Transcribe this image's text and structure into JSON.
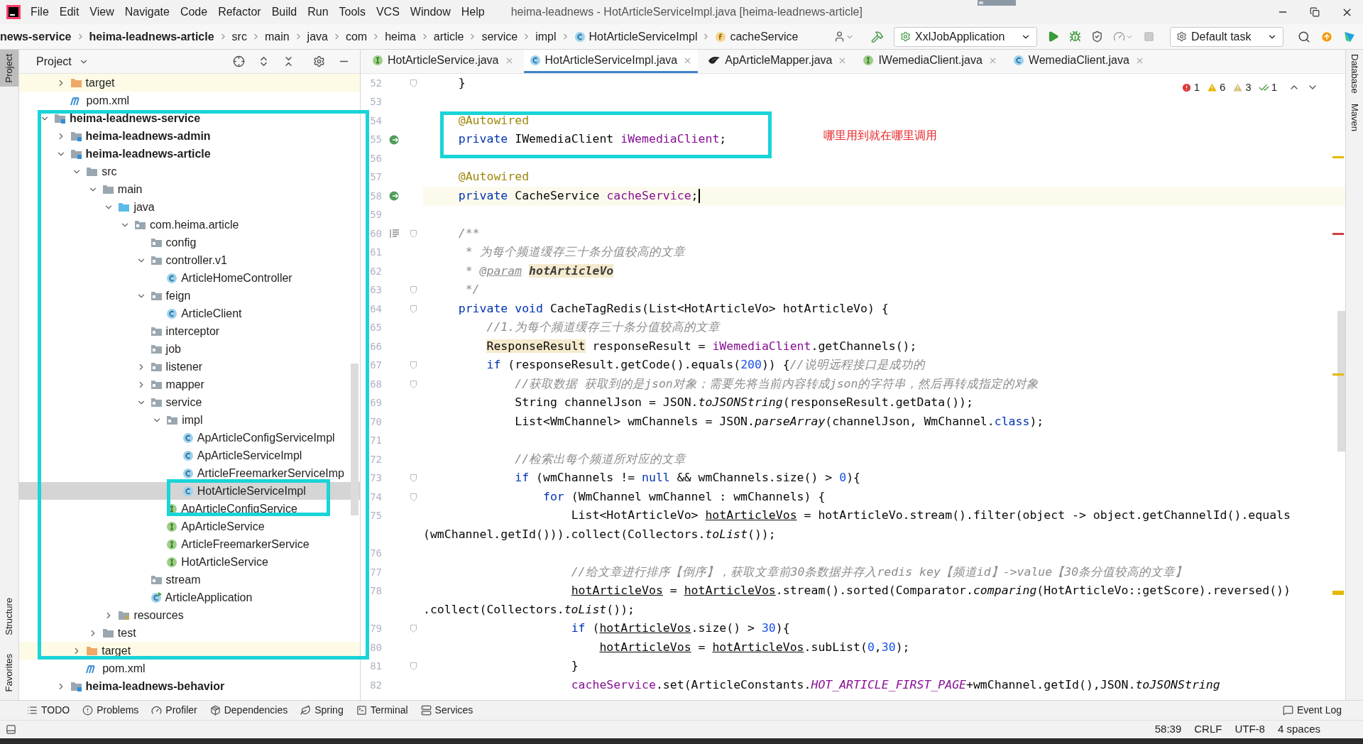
{
  "window": {
    "title": "heima-leadnews - HotArticleServiceImpl.java [heima-leadnews-article]"
  },
  "menu": [
    "File",
    "Edit",
    "View",
    "Navigate",
    "Code",
    "Refactor",
    "Build",
    "Run",
    "Tools",
    "VCS",
    "Window",
    "Help"
  ],
  "breadcrumbs": [
    {
      "label": "news-service",
      "kind": "module"
    },
    {
      "label": "heima-leadnews-article",
      "kind": "module"
    },
    {
      "label": "src",
      "kind": "folder"
    },
    {
      "label": "main",
      "kind": "folder"
    },
    {
      "label": "java",
      "kind": "folder"
    },
    {
      "label": "com",
      "kind": "folder"
    },
    {
      "label": "heima",
      "kind": "folder"
    },
    {
      "label": "article",
      "kind": "folder"
    },
    {
      "label": "service",
      "kind": "folder"
    },
    {
      "label": "impl",
      "kind": "folder"
    },
    {
      "label": "HotArticleServiceImpl",
      "kind": "class"
    },
    {
      "label": "cacheService",
      "kind": "field"
    }
  ],
  "toolbar": {
    "run_config": "XxlJobApplication",
    "task": "Default task"
  },
  "left_stripe": [
    {
      "label": "Project",
      "selected": true
    },
    {
      "label": "Structure",
      "selected": false
    },
    {
      "label": "Favorites",
      "selected": false
    }
  ],
  "project_panel": {
    "title": "Project",
    "orphan_items": [
      {
        "label": "target",
        "kind": "excluded",
        "expanded": false,
        "selected": false
      },
      {
        "label": "pom.xml",
        "kind": "maven",
        "selected": false
      }
    ],
    "items": [
      {
        "label": "heima-leadnews-service",
        "kind": "module",
        "expanded": true,
        "selected": false,
        "children": [
          {
            "label": "heima-leadnews-admin",
            "kind": "module",
            "expanded": false,
            "selected": false
          },
          {
            "label": "heima-leadnews-article",
            "kind": "module",
            "expanded": true,
            "selected": false,
            "children": [
              {
                "label": "src",
                "kind": "folder",
                "expanded": true,
                "selected": false,
                "children": [
                  {
                    "label": "main",
                    "kind": "folder",
                    "expanded": true,
                    "selected": false,
                    "children": [
                      {
                        "label": "java",
                        "kind": "source-root",
                        "expanded": true,
                        "selected": false,
                        "children": [
                          {
                            "label": "com.heima.article",
                            "kind": "package",
                            "expanded": true,
                            "selected": false,
                            "children": [
                              {
                                "label": "config",
                                "kind": "package",
                                "selected": false
                              },
                              {
                                "label": "controller.v1",
                                "kind": "package",
                                "expanded": true,
                                "selected": false,
                                "children": [
                                  {
                                    "label": "ArticleHomeController",
                                    "kind": "class",
                                    "selected": false
                                  }
                                ]
                              },
                              {
                                "label": "feign",
                                "kind": "package",
                                "expanded": true,
                                "selected": false,
                                "children": [
                                  {
                                    "label": "ArticleClient",
                                    "kind": "class",
                                    "selected": false
                                  }
                                ]
                              },
                              {
                                "label": "interceptor",
                                "kind": "package",
                                "selected": false
                              },
                              {
                                "label": "job",
                                "kind": "package",
                                "selected": false
                              },
                              {
                                "label": "listener",
                                "kind": "package",
                                "expanded": false,
                                "selected": false
                              },
                              {
                                "label": "mapper",
                                "kind": "package",
                                "expanded": false,
                                "selected": false
                              },
                              {
                                "label": "service",
                                "kind": "package",
                                "expanded": true,
                                "selected": false,
                                "children": [
                                  {
                                    "label": "impl",
                                    "kind": "package",
                                    "expanded": true,
                                    "selected": false,
                                    "children": [
                                      {
                                        "label": "ApArticleConfigServiceImpl",
                                        "kind": "class",
                                        "selected": false
                                      },
                                      {
                                        "label": "ApArticleServiceImpl",
                                        "kind": "class",
                                        "selected": false
                                      },
                                      {
                                        "label": "ArticleFreemarkerServiceImp",
                                        "kind": "class",
                                        "selected": false
                                      },
                                      {
                                        "label": "HotArticleServiceImpl",
                                        "kind": "class",
                                        "selected": true
                                      }
                                    ]
                                  },
                                  {
                                    "label": "ApArticleConfigService",
                                    "kind": "interface",
                                    "selected": false
                                  },
                                  {
                                    "label": "ApArticleService",
                                    "kind": "interface",
                                    "selected": false
                                  },
                                  {
                                    "label": "ArticleFreemarkerService",
                                    "kind": "interface",
                                    "selected": false
                                  },
                                  {
                                    "label": "HotArticleService",
                                    "kind": "interface",
                                    "selected": false
                                  }
                                ]
                              },
                              {
                                "label": "stream",
                                "kind": "package",
                                "selected": false
                              },
                              {
                                "label": "ArticleApplication",
                                "kind": "app",
                                "selected": false
                              }
                            ]
                          }
                        ]
                      },
                      {
                        "label": "resources",
                        "kind": "resources",
                        "expanded": false,
                        "selected": false
                      }
                    ]
                  },
                  {
                    "label": "test",
                    "kind": "folder",
                    "expanded": false,
                    "selected": false
                  }
                ]
              },
              {
                "label": "target",
                "kind": "excluded",
                "expanded": false,
                "selected": false
              },
              {
                "label": "pom.xml",
                "kind": "maven",
                "selected": false
              }
            ]
          },
          {
            "label": "heima-leadnews-behavior",
            "kind": "module",
            "expanded": false,
            "selected": false
          }
        ]
      }
    ]
  },
  "tabs": [
    {
      "label": "HotArticleService.java",
      "kind": "interface",
      "selected": false
    },
    {
      "label": "HotArticleServiceImpl.java",
      "kind": "class",
      "selected": true
    },
    {
      "label": "ApArticleMapper.java",
      "kind": "mapper",
      "selected": false
    },
    {
      "label": "IWemediaClient.java",
      "kind": "interface",
      "selected": false
    },
    {
      "label": "WemediaClient.java",
      "kind": "class",
      "selected": false
    }
  ],
  "editor": {
    "inspections": [
      {
        "kind": "error",
        "count": "1"
      },
      {
        "kind": "warning",
        "count": "6"
      },
      {
        "kind": "weak-warning",
        "count": "3"
      },
      {
        "kind": "typo",
        "count": "1"
      }
    ],
    "note": "哪里用到就在哪里调用",
    "lines": [
      {
        "number": "52",
        "fold": true,
        "tokens": [
          {
            "text": "    }",
            "kind": "plain"
          }
        ]
      },
      {
        "number": "53",
        "fold": false
      },
      {
        "number": "54",
        "fold": false,
        "tokens": [
          {
            "text": "    @Autowired",
            "kind": "annotation"
          }
        ]
      },
      {
        "number": "55",
        "fold": false,
        "gutter": {
          "kind": "bean"
        },
        "tokens": [
          {
            "text": "    private",
            "kind": "keyword"
          },
          {
            "text": " IWemediaClient ",
            "kind": "plain"
          },
          {
            "text": "iWemediaClient",
            "kind": "field"
          },
          {
            "text": ";",
            "kind": "plain"
          }
        ]
      },
      {
        "number": "56",
        "fold": false
      },
      {
        "number": "57",
        "fold": false,
        "tokens": [
          {
            "text": "    @Autowired",
            "kind": "annotation"
          }
        ]
      },
      {
        "number": "58",
        "fold": false,
        "current": true,
        "gutter": {
          "kind": "bean"
        },
        "tokens": [
          {
            "text": "    private",
            "kind": "keyword"
          },
          {
            "text": " CacheService ",
            "kind": "plain"
          },
          {
            "text": "cacheService",
            "kind": "field"
          },
          {
            "text": ";",
            "kind": "plain"
          }
        ]
      },
      {
        "number": "59",
        "fold": false
      },
      {
        "number": "60",
        "fold": true,
        "gutter": {
          "kind": "doc"
        },
        "tokens": [
          {
            "text": "    /**",
            "kind": "comment"
          }
        ]
      },
      {
        "number": "61",
        "fold": false,
        "tokens": [
          {
            "text": "     * 为每个频道缓存三十条分值较高的文章",
            "kind": "comment"
          }
        ]
      },
      {
        "number": "62",
        "fold": false,
        "tokens": [
          {
            "text": "     *",
            "kind": "comment"
          },
          {
            "text": " @param",
            "kind": "doc-tag"
          },
          {
            "text": " hotArticleVo",
            "kind": "doc-param"
          }
        ]
      },
      {
        "number": "63",
        "fold": true,
        "tokens": [
          {
            "text": "     */",
            "kind": "comment"
          }
        ]
      },
      {
        "number": "64",
        "fold": true,
        "tokens": [
          {
            "text": "    private void",
            "kind": "keyword"
          },
          {
            "text": " CacheTagRedis(List<HotArticleVo> hotArticleVo) {",
            "kind": "plain"
          }
        ]
      },
      {
        "number": "65",
        "fold": false,
        "tokens": [
          {
            "text": "        //1.为每个频道缓存三十条分值较高的文章",
            "kind": "comment"
          }
        ]
      },
      {
        "number": "66",
        "fold": false,
        "tokens": [
          {
            "text": "        ResponseResult",
            "kind": "marked"
          },
          {
            "text": " responseResult = ",
            "kind": "plain"
          },
          {
            "text": "iWemediaClient",
            "kind": "field"
          },
          {
            "text": ".getChannels();",
            "kind": "plain"
          }
        ]
      },
      {
        "number": "67",
        "fold": true,
        "tokens": [
          {
            "text": "        if",
            "kind": "keyword"
          },
          {
            "text": " (responseResult.getCode().equals(",
            "kind": "plain"
          },
          {
            "text": "200",
            "kind": "number"
          },
          {
            "text": ")) {",
            "kind": "plain"
          },
          {
            "text": "//说明远程接口是成功的",
            "kind": "comment"
          }
        ]
      },
      {
        "number": "68",
        "fold": true,
        "tokens": [
          {
            "text": "            //获取数据 获取到的是json对象；需要先将当前内容转成json的字符串，然后再转成指定的对象",
            "kind": "comment"
          }
        ]
      },
      {
        "number": "69",
        "fold": false,
        "tokens": [
          {
            "text": "            String channelJson = JSON.",
            "kind": "plain"
          },
          {
            "text": "toJSONString",
            "kind": "static-call"
          },
          {
            "text": "(responseResult.getData());",
            "kind": "plain"
          }
        ]
      },
      {
        "number": "70",
        "fold": false,
        "tokens": [
          {
            "text": "            List<WmChannel> wmChannels = JSON.",
            "kind": "plain"
          },
          {
            "text": "parseArray",
            "kind": "static-call"
          },
          {
            "text": "(channelJson, WmChannel.",
            "kind": "plain"
          },
          {
            "text": "class",
            "kind": "keyword"
          },
          {
            "text": ");",
            "kind": "plain"
          }
        ]
      },
      {
        "number": "71",
        "fold": false
      },
      {
        "number": "72",
        "fold": false,
        "tokens": [
          {
            "text": "            //检索出每个频道所对应的文章",
            "kind": "comment"
          }
        ]
      },
      {
        "number": "73",
        "fold": true,
        "tokens": [
          {
            "text": "            if",
            "kind": "keyword"
          },
          {
            "text": " (wmChannels != ",
            "kind": "plain"
          },
          {
            "text": "null",
            "kind": "keyword"
          },
          {
            "text": " && wmChannels.size() > ",
            "kind": "plain"
          },
          {
            "text": "0",
            "kind": "number"
          },
          {
            "text": "){",
            "kind": "plain"
          }
        ]
      },
      {
        "number": "74",
        "fold": true,
        "tokens": [
          {
            "text": "                for",
            "kind": "keyword"
          },
          {
            "text": " (WmChannel wmChannel : wmChannels) {",
            "kind": "plain"
          }
        ]
      },
      {
        "number": "75",
        "fold": false,
        "tokens": [
          {
            "text": "                    List<HotArticleVo> ",
            "kind": "plain"
          },
          {
            "text": "hotArticleVos",
            "kind": "reassigned"
          },
          {
            "text": " = hotArticleVo.stream().filter(object -> object.getChannelId().equals",
            "kind": "plain"
          }
        ],
        "wrapped": [
          {
            "text": "(wmChannel.getId())).collect(Collectors.",
            "kind": "plain"
          },
          {
            "text": "toList",
            "kind": "static-call"
          },
          {
            "text": "());",
            "kind": "plain"
          }
        ]
      },
      {
        "number": "76",
        "fold": false
      },
      {
        "number": "77",
        "fold": false,
        "tokens": [
          {
            "text": "                    //给文章进行排序【倒序】，获取文章前30条数据并存入redis key【频道id】->value【30条分值较高的文章】",
            "kind": "comment"
          }
        ]
      },
      {
        "number": "78",
        "fold": false,
        "tokens": [
          {
            "text": "                    hotArticleVos",
            "kind": "reassigned"
          },
          {
            "text": " = ",
            "kind": "plain"
          },
          {
            "text": "hotArticleVos",
            "kind": "reassigned"
          },
          {
            "text": ".stream().sorted(Comparator.",
            "kind": "plain"
          },
          {
            "text": "comparing",
            "kind": "static-call"
          },
          {
            "text": "(HotArticleVo::getScore).reversed())",
            "kind": "plain"
          }
        ],
        "wrapped": [
          {
            "text": ".collect(Collectors.",
            "kind": "plain"
          },
          {
            "text": "toList",
            "kind": "static-call"
          },
          {
            "text": "());",
            "kind": "plain"
          }
        ]
      },
      {
        "number": "79",
        "fold": true,
        "tokens": [
          {
            "text": "                    if",
            "kind": "keyword"
          },
          {
            "text": " (",
            "kind": "plain"
          },
          {
            "text": "hotArticleVos",
            "kind": "reassigned"
          },
          {
            "text": ".size() > ",
            "kind": "plain"
          },
          {
            "text": "30",
            "kind": "number"
          },
          {
            "text": "){",
            "kind": "plain"
          }
        ]
      },
      {
        "number": "80",
        "fold": false,
        "tokens": [
          {
            "text": "                        hotArticleVos",
            "kind": "reassigned"
          },
          {
            "text": " = ",
            "kind": "plain"
          },
          {
            "text": "hotArticleVos",
            "kind": "reassigned"
          },
          {
            "text": ".subList(",
            "kind": "plain"
          },
          {
            "text": "0",
            "kind": "number"
          },
          {
            "text": ",",
            "kind": "plain"
          },
          {
            "text": "30",
            "kind": "number"
          },
          {
            "text": ");",
            "kind": "plain"
          }
        ]
      },
      {
        "number": "81",
        "fold": true,
        "tokens": [
          {
            "text": "                    }",
            "kind": "plain"
          }
        ]
      },
      {
        "number": "82",
        "fold": false,
        "tokens": [
          {
            "text": "                    cacheService",
            "kind": "field"
          },
          {
            "text": ".set(ArticleConstants.",
            "kind": "plain"
          },
          {
            "text": "HOT_ARTICLE_FIRST_PAGE",
            "kind": "constant"
          },
          {
            "text": "+wmChannel.getId(),JSON.",
            "kind": "plain"
          },
          {
            "text": "toJSONString",
            "kind": "static-call"
          }
        ]
      }
    ]
  },
  "right_stripe": [
    "Database",
    "Maven"
  ],
  "tool_windows": [
    {
      "label": "TODO",
      "kind": "todo"
    },
    {
      "label": "Problems",
      "kind": "problems"
    },
    {
      "label": "Profiler",
      "kind": "profiler"
    },
    {
      "label": "Dependencies",
      "kind": "dependencies"
    },
    {
      "label": "Spring",
      "kind": "spring"
    },
    {
      "label": "Terminal",
      "kind": "terminal"
    },
    {
      "label": "Services",
      "kind": "services"
    }
  ],
  "event_log": "Event Log",
  "status_bar": [
    "58:39",
    "CRLF",
    "UTF-8",
    "4 spaces"
  ]
}
